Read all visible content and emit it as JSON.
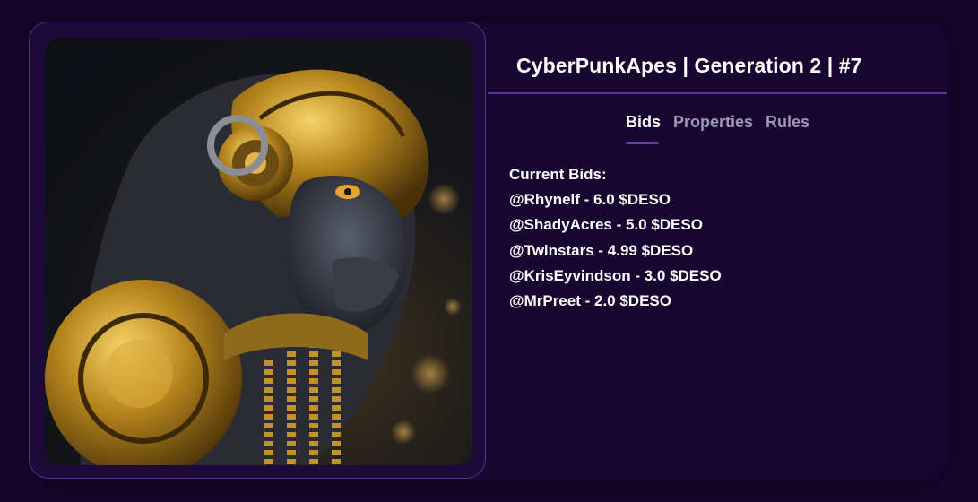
{
  "nft": {
    "title": "CyberPunkApes | Generation 2 | #7",
    "image": "cyberpunk-ape-gold-armor-artwork"
  },
  "tabs": [
    {
      "label": "Bids",
      "active": true
    },
    {
      "label": "Properties",
      "active": false
    },
    {
      "label": "Rules",
      "active": false
    }
  ],
  "bids": {
    "heading": "Current Bids:",
    "items": [
      "@Rhynelf - 6.0 $DESO",
      "@ShadyAcres - 5.0 $DESO",
      "@Twinstars - 4.99 $DESO",
      "@KrisEyvindson - 3.0 $DESO",
      "@MrPreet - 2.0 $DESO"
    ]
  },
  "colors": {
    "background": "#14062b",
    "card": "#160630",
    "accent": "#5c2f94",
    "text": "#ffffff",
    "inactive_tab": "#9c97b5"
  }
}
